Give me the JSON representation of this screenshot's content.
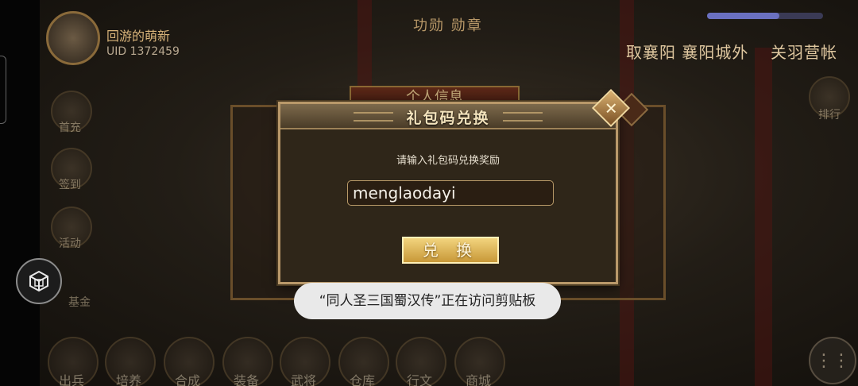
{
  "player": {
    "name": "回游的萌新",
    "uid": "UID 1372459"
  },
  "top_bar": {
    "center_text": "功勋 勋章",
    "location_1": "取襄阳 襄阳城外",
    "location_2": "关羽营帐"
  },
  "side_menu": [
    "首充",
    "签到",
    "活动",
    "基金"
  ],
  "right_menu": [
    "排行"
  ],
  "bottom_menu": [
    "出兵",
    "培养",
    "合成",
    "装备",
    "武将",
    "仓库",
    "行文",
    "商城"
  ],
  "background_panel": {
    "title": "个人信息"
  },
  "dialog": {
    "title": "礼包码兑换",
    "prompt": "请输入礼包码兑换奖励",
    "input_value": "menglaodayi",
    "redeem_label": "兑 换",
    "close_symbol": "✕"
  },
  "toast": {
    "message": "“同人圣三国蜀汉传”正在访问剪贴板"
  },
  "colors": {
    "dialog_bg": "#2f2619",
    "dialog_border": "#b9996a",
    "button_gold": "#e4bd5c",
    "toast_bg": "#e9e9e9"
  }
}
